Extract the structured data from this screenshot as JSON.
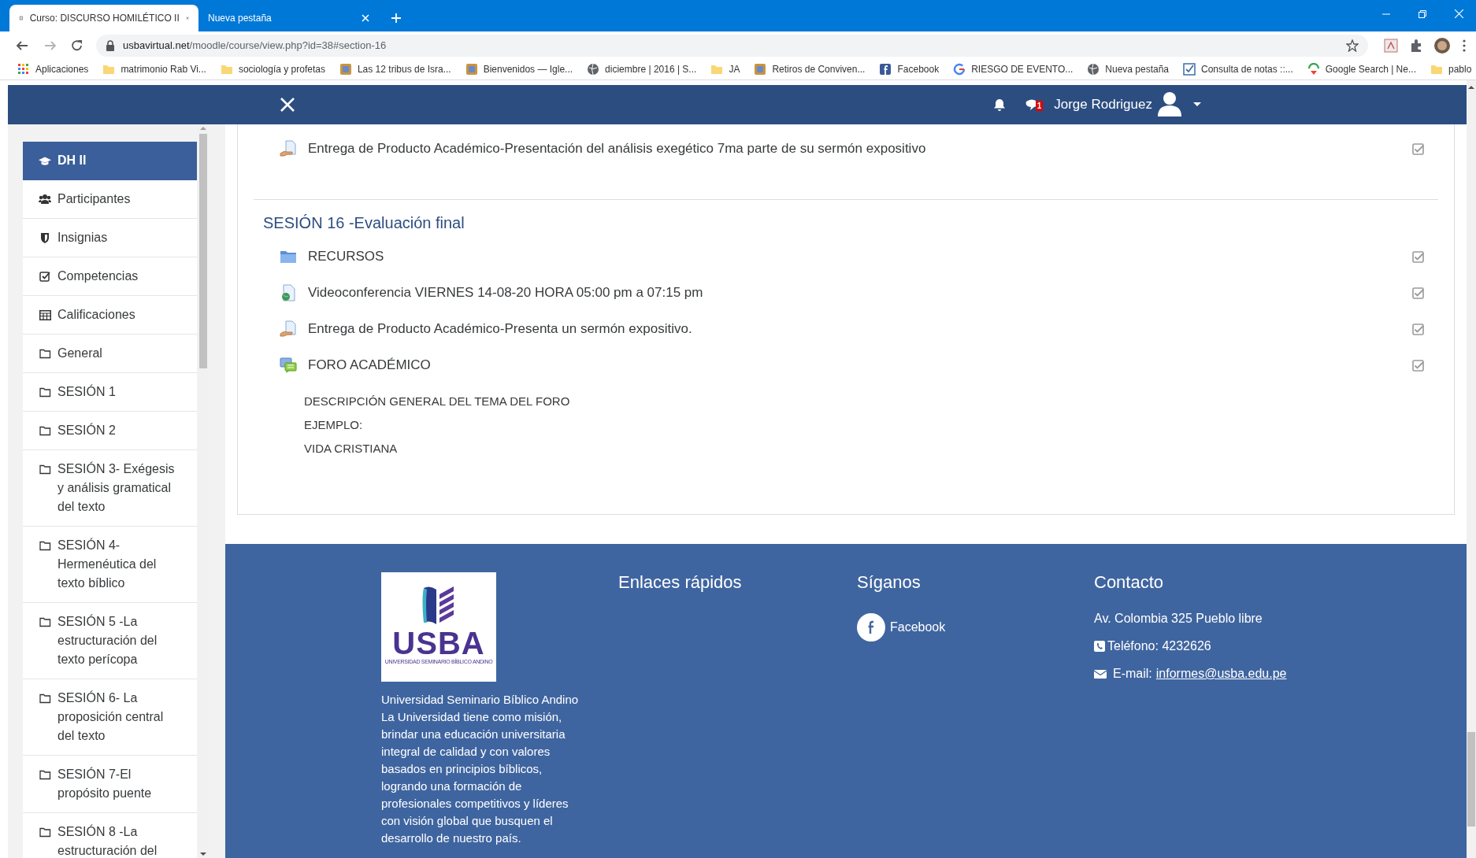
{
  "browser": {
    "tabs": [
      {
        "title": "Curso: DISCURSO HOMILÉTICO II",
        "selected": true
      },
      {
        "title": "Nueva pestaña",
        "selected": false
      }
    ],
    "url": {
      "host": "usbavirtual.net",
      "path": "/moodle/course/view.php?id=38#section-16"
    },
    "bookmarks": [
      {
        "label": "Aplicaciones",
        "kind": "apps"
      },
      {
        "label": "matrimonio Rab Vi...",
        "kind": "folder"
      },
      {
        "label": "sociología y profetas",
        "kind": "folder"
      },
      {
        "label": "Las 12 tribus de Isra...",
        "kind": "site"
      },
      {
        "label": "Bienvenidos — Igle...",
        "kind": "site"
      },
      {
        "label": "diciembre | 2016 | S...",
        "kind": "globe"
      },
      {
        "label": "JA",
        "kind": "folder"
      },
      {
        "label": "Retiros de Conviven...",
        "kind": "site"
      },
      {
        "label": "Facebook",
        "kind": "facebook"
      },
      {
        "label": "RIESGO DE EVENTO...",
        "kind": "google"
      },
      {
        "label": "Nueva pestaña",
        "kind": "globe"
      },
      {
        "label": "Consulta de notas ::...",
        "kind": "check"
      },
      {
        "label": "Google Search | Ne...",
        "kind": "search"
      },
      {
        "label": "pablo",
        "kind": "folder"
      }
    ]
  },
  "navbar": {
    "message_count": "1",
    "user_name": "Jorge Rodriguez"
  },
  "sidebar": {
    "items": [
      {
        "label": "DH II",
        "kind": "course",
        "selected": true
      },
      {
        "label": "Participantes",
        "kind": "users",
        "selected": false
      },
      {
        "label": "Insignias",
        "kind": "badge",
        "selected": false
      },
      {
        "label": "Competencias",
        "kind": "check",
        "selected": false
      },
      {
        "label": "Calificaciones",
        "kind": "table",
        "selected": false
      },
      {
        "label": "General",
        "kind": "folder",
        "selected": false
      },
      {
        "label": "SESIÓN 1",
        "kind": "folder",
        "selected": false
      },
      {
        "label": "SESIÓN 2",
        "kind": "folder",
        "selected": false
      },
      {
        "label": "SESIÓN 3- Exégesis y análisis gramatical del texto",
        "kind": "folder",
        "selected": false
      },
      {
        "label": "SESIÓN 4- Hermenéutica del texto bíblico",
        "kind": "folder",
        "selected": false
      },
      {
        "label": "SESIÓN 5 -La estructuración del texto perícopa",
        "kind": "folder",
        "selected": false
      },
      {
        "label": "SESIÓN 6- La proposición central del texto",
        "kind": "folder",
        "selected": false
      },
      {
        "label": "SESIÓN 7-El propósito puente",
        "kind": "folder",
        "selected": false
      },
      {
        "label": "SESIÓN 8 -La estructuración del",
        "kind": "folder",
        "selected": false
      }
    ]
  },
  "content": {
    "activities_above": [
      {
        "kind": "assignment",
        "label": "Entrega de Producto Académico-Presentación del análisis exegético 7ma parte de su sermón expositivo",
        "completed": true
      }
    ],
    "section": {
      "title": "SESIÓN 16 -Evaluación final",
      "activities": [
        {
          "kind": "folder",
          "label": "RECURSOS",
          "completed": true
        },
        {
          "kind": "url",
          "label": "Videoconferencia VIERNES 14-08-20 HORA 05:00 pm a 07:15 pm",
          "completed": true
        },
        {
          "kind": "assignment",
          "label": "Entrega de Producto Académico-Presenta un sermón expositivo.",
          "completed": true
        },
        {
          "kind": "forum",
          "label": "FORO ACADÉMICO",
          "completed": true
        }
      ],
      "description": [
        "DESCRIPCIÓN GENERAL DEL TEMA DEL FORO",
        "EJEMPLO:",
        "VIDA CRISTIANA"
      ]
    }
  },
  "footer": {
    "logo": {
      "wordmark": "USBA",
      "tagline": "UNIVERSIDAD SEMINARIO BÍBLICO ANDINO"
    },
    "name": "Universidad Seminario Bíblico Andino",
    "mission": "La Universidad tiene como misión, brindar una educación universitaria integral de calidad y con valores basados en principios bíblicos, logrando una formación de profesionales competitivos y líderes con visión global que busquen el desarrollo de nuestro país.",
    "links_heading": "Enlaces rápidos",
    "follow_heading": "Síganos",
    "social": [
      {
        "kind": "facebook",
        "label": "Facebook"
      }
    ],
    "contact_heading": "Contacto",
    "address": "Av. Colombia 325 Pueblo libre",
    "phone": "Teléfono: 4232626",
    "email_label": "E-mail:",
    "email": "informes@usba.edu.pe"
  }
}
